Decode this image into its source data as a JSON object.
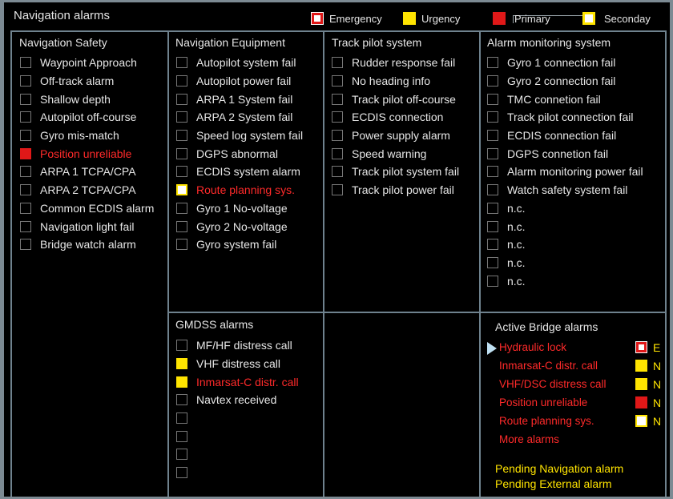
{
  "title": "Navigation alarms",
  "legend": {
    "emergency": "Emergency",
    "urgency": "Urgency",
    "primary": "Primary",
    "secondary": "Seconday"
  },
  "colors": {
    "red": "#e01818",
    "yellow": "#ffe400",
    "text": "#e6e6e6",
    "alarm_text": "#ff2a2a",
    "grid": "#6f828e"
  },
  "panels": {
    "nav_safety": {
      "title": "Navigation Safety",
      "items": [
        {
          "label": "Waypoint Approach",
          "state": "off"
        },
        {
          "label": "Off-track alarm",
          "state": "off"
        },
        {
          "label": "Shallow depth",
          "state": "off"
        },
        {
          "label": "Autopilot off-course",
          "state": "off"
        },
        {
          "label": "Gyro mis-match",
          "state": "off"
        },
        {
          "label": "Position unreliable",
          "state": "red"
        },
        {
          "label": "ARPA 1 TCPA/CPA",
          "state": "off"
        },
        {
          "label": "ARPA 2 TCPA/CPA",
          "state": "off"
        },
        {
          "label": "Common ECDIS alarm",
          "state": "off"
        },
        {
          "label": "Navigation light fail",
          "state": "off"
        },
        {
          "label": "Bridge watch alarm",
          "state": "off"
        }
      ]
    },
    "nav_equipment": {
      "title": "Navigation Equipment",
      "items": [
        {
          "label": "Autopilot system fail",
          "state": "off"
        },
        {
          "label": "Autopilot power fail",
          "state": "off"
        },
        {
          "label": "ARPA 1 System fail",
          "state": "off"
        },
        {
          "label": "ARPA 2 System fail",
          "state": "off"
        },
        {
          "label": "Speed log system fail",
          "state": "off"
        },
        {
          "label": "DGPS abnormal",
          "state": "off"
        },
        {
          "label": "ECDIS system alarm",
          "state": "off"
        },
        {
          "label": "Route planning sys.",
          "state": "white-y"
        },
        {
          "label": "Gyro 1 No-voltage",
          "state": "off"
        },
        {
          "label": "Gyro 2 No-voltage",
          "state": "off"
        },
        {
          "label": "Gyro system fail",
          "state": "off"
        }
      ]
    },
    "track_pilot": {
      "title": "Track pilot system",
      "items": [
        {
          "label": "Rudder response fail",
          "state": "off"
        },
        {
          "label": "No heading info",
          "state": "off"
        },
        {
          "label": "Track pilot off-course",
          "state": "off"
        },
        {
          "label": "ECDIS connection",
          "state": "off"
        },
        {
          "label": "Power supply alarm",
          "state": "off"
        },
        {
          "label": "Speed warning",
          "state": "off"
        },
        {
          "label": "Track pilot system fail",
          "state": "off"
        },
        {
          "label": "Track pilot power fail",
          "state": "off"
        }
      ]
    },
    "alarm_monitoring": {
      "title": "Alarm monitoring system",
      "items": [
        {
          "label": "Gyro 1 connection fail",
          "state": "off"
        },
        {
          "label": "Gyro 2 connection fail",
          "state": "off"
        },
        {
          "label": "TMC connetion fail",
          "state": "off"
        },
        {
          "label": "Track pilot connection fail",
          "state": "off"
        },
        {
          "label": "ECDIS connection fail",
          "state": "off"
        },
        {
          "label": "DGPS connetion fail",
          "state": "off"
        },
        {
          "label": "Alarm monitoring power fail",
          "state": "off"
        },
        {
          "label": "Watch safety system fail",
          "state": "off"
        },
        {
          "label": "n.c.",
          "state": "off"
        },
        {
          "label": "n.c.",
          "state": "off"
        },
        {
          "label": "n.c.",
          "state": "off"
        },
        {
          "label": "n.c.",
          "state": "off"
        },
        {
          "label": "n.c.",
          "state": "off"
        }
      ]
    },
    "gmdss": {
      "title": "GMDSS alarms",
      "items": [
        {
          "label": "MF/HF distress call",
          "state": "off"
        },
        {
          "label": "VHF distress call",
          "state": "yellow"
        },
        {
          "label": "Inmarsat-C distr. call",
          "state": "yellow"
        },
        {
          "label": "Navtex received",
          "state": "off"
        },
        {
          "label": "",
          "state": "off"
        },
        {
          "label": "",
          "state": "off"
        },
        {
          "label": "",
          "state": "off"
        },
        {
          "label": "",
          "state": "off"
        }
      ]
    }
  },
  "active_bridge": {
    "title": "Active Bridge alarms",
    "items": [
      {
        "label": "Hydraulic lock",
        "type": "em",
        "code": "E",
        "selected": true
      },
      {
        "label": "Inmarsat-C distr. call",
        "type": "yellow",
        "code": "N",
        "selected": false
      },
      {
        "label": "VHF/DSC distress call",
        "type": "yellow",
        "code": "N",
        "selected": false
      },
      {
        "label": "Position unreliable",
        "type": "red",
        "code": "N",
        "selected": false
      },
      {
        "label": "Route planning sys.",
        "type": "white-y",
        "code": "N",
        "selected": false
      }
    ],
    "more": "More alarms",
    "pending_nav": "Pending Navigation alarm",
    "pending_ext": "Pending External alarm"
  }
}
